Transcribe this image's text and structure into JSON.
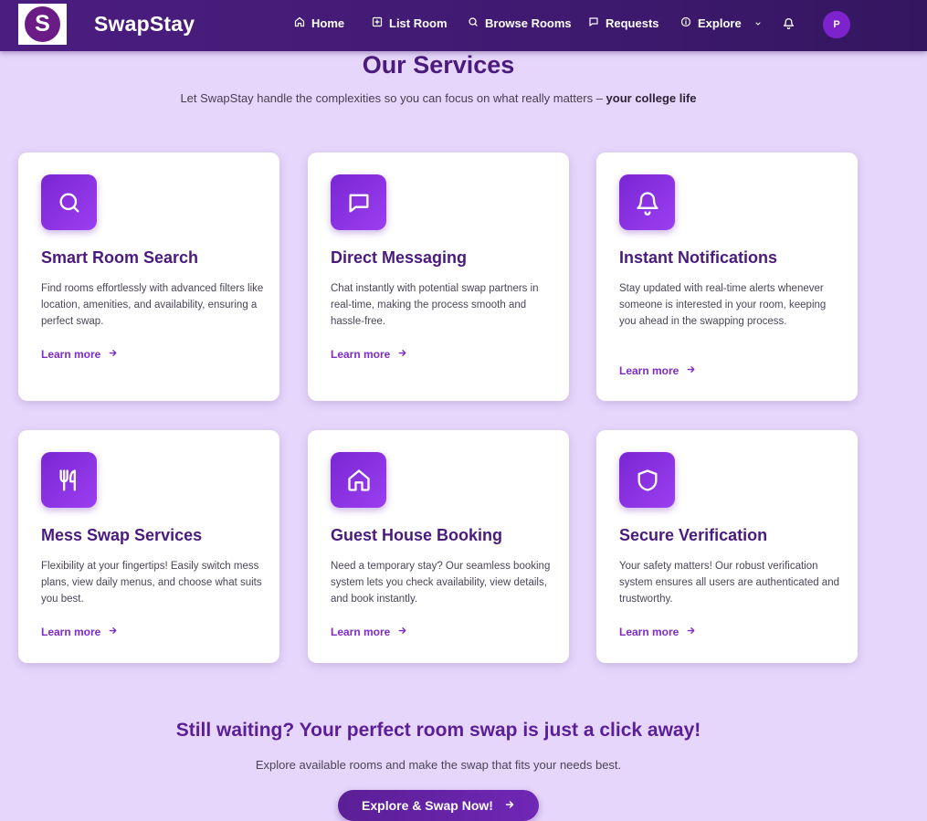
{
  "nav": {
    "logo_letter": "S",
    "brand": "SwapStay",
    "items": [
      {
        "label": "Home",
        "icon": "home-icon"
      },
      {
        "label": "List Room",
        "icon": "plus-square-icon"
      },
      {
        "label": "Browse Rooms",
        "icon": "search-icon"
      },
      {
        "label": "Requests",
        "icon": "message-icon"
      },
      {
        "label": "Explore",
        "icon": "info-icon",
        "dropdown": true
      }
    ],
    "notification_icon": "bell-icon",
    "avatar_initial": "P"
  },
  "header": {
    "title": "Our Services",
    "subtitle_text": "Let SwapStay handle the complexities so you can focus on what really matters – ",
    "subtitle_bold": "your college life"
  },
  "services": [
    {
      "title": "Smart Room Search",
      "icon": "search-icon",
      "description": "Find rooms effortlessly with advanced filters like location, amenities, and availability, ensuring a perfect swap.",
      "link": "Learn more"
    },
    {
      "title": "Direct Messaging",
      "icon": "message-icon",
      "description": "Chat instantly with potential swap partners in real-time, making the process smooth and hassle-free.",
      "link": "Learn more"
    },
    {
      "title": "Instant Notifications",
      "icon": "bell-icon",
      "description": "Stay updated with real-time alerts whenever someone is interested in your room, keeping you ahead in the swapping process.",
      "link": "Learn more"
    },
    {
      "title": "Mess Swap Services",
      "icon": "utensils-icon",
      "description": "Flexibility at your fingertips! Easily switch mess plans, view daily menus, and choose what suits you best.",
      "link": "Learn more"
    },
    {
      "title": "Guest House Booking",
      "icon": "home-icon",
      "description": "Need a temporary stay? Our seamless booking system lets you check availability, view details, and book instantly.",
      "link": "Learn more"
    },
    {
      "title": "Secure Verification",
      "icon": "shield-icon",
      "description": "Your safety matters! Our robust verification system ensures all users are authenticated and trustworthy.",
      "link": "Learn more"
    }
  ],
  "cta": {
    "title": "Still waiting? Your perfect room swap is just a click away!",
    "subtitle": "Explore available rooms and make the swap that fits your needs best.",
    "button": "Explore & Swap Now!"
  },
  "colors": {
    "page_background": "#e6d6fb",
    "nav_background": "#4b1d80",
    "accent": "#7e22ce",
    "heading": "#4a1a7d"
  }
}
